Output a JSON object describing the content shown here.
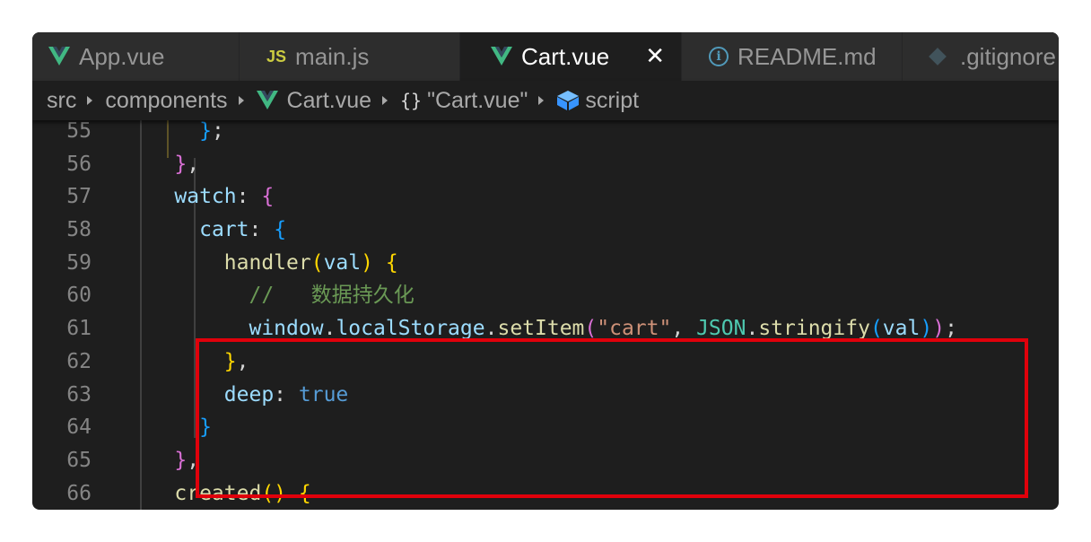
{
  "tabs": [
    {
      "label": "App.vue",
      "icon": "vue-icon",
      "active": false
    },
    {
      "label": "main.js",
      "icon": "js-icon",
      "icon_text": "JS",
      "active": false
    },
    {
      "label": "Cart.vue",
      "icon": "vue-icon",
      "active": true,
      "close": "✕"
    },
    {
      "label": "README.md",
      "icon": "info-icon",
      "icon_text": "i",
      "active": false
    },
    {
      "label": ".gitignore",
      "icon": "git-icon",
      "active": false
    }
  ],
  "breadcrumb": {
    "items": [
      "src",
      "components",
      "Cart.vue",
      "\"Cart.vue\"",
      "script"
    ],
    "braces": "{}"
  },
  "editor": {
    "line_numbers": [
      "55",
      "56",
      "57",
      "58",
      "59",
      "60",
      "61",
      "62",
      "63",
      "64",
      "65",
      "66"
    ],
    "lines": [
      [
        {
          "t": "      ",
          "c": "t-punct"
        },
        {
          "t": "}",
          "c": "t-b3"
        },
        {
          "t": ";",
          "c": "t-punct"
        }
      ],
      [
        {
          "t": "    ",
          "c": "t-punct"
        },
        {
          "t": "}",
          "c": "t-b2"
        },
        {
          "t": ",",
          "c": "t-punct"
        }
      ],
      [
        {
          "t": "    ",
          "c": "t-punct"
        },
        {
          "t": "watch",
          "c": "t-key"
        },
        {
          "t": ": ",
          "c": "t-punct"
        },
        {
          "t": "{",
          "c": "t-b2"
        }
      ],
      [
        {
          "t": "      ",
          "c": "t-punct"
        },
        {
          "t": "cart",
          "c": "t-key"
        },
        {
          "t": ": ",
          "c": "t-punct"
        },
        {
          "t": "{",
          "c": "t-b3"
        }
      ],
      [
        {
          "t": "        ",
          "c": "t-punct"
        },
        {
          "t": "handler",
          "c": "t-fn"
        },
        {
          "t": "(",
          "c": "t-b1"
        },
        {
          "t": "val",
          "c": "t-key"
        },
        {
          "t": ")",
          "c": "t-b1"
        },
        {
          "t": " ",
          "c": "t-punct"
        },
        {
          "t": "{",
          "c": "t-b1"
        }
      ],
      [
        {
          "t": "          ",
          "c": "t-punct"
        },
        {
          "t": "//   数据持久化",
          "c": "t-com"
        }
      ],
      [
        {
          "t": "          ",
          "c": "t-punct"
        },
        {
          "t": "window",
          "c": "t-key"
        },
        {
          "t": ".",
          "c": "t-punct"
        },
        {
          "t": "localStorage",
          "c": "t-key"
        },
        {
          "t": ".",
          "c": "t-punct"
        },
        {
          "t": "setItem",
          "c": "t-fn"
        },
        {
          "t": "(",
          "c": "t-b2"
        },
        {
          "t": "\"cart\"",
          "c": "t-str"
        },
        {
          "t": ", ",
          "c": "t-punct"
        },
        {
          "t": "JSON",
          "c": "t-cls"
        },
        {
          "t": ".",
          "c": "t-punct"
        },
        {
          "t": "stringify",
          "c": "t-fn"
        },
        {
          "t": "(",
          "c": "t-b3"
        },
        {
          "t": "val",
          "c": "t-key"
        },
        {
          "t": ")",
          "c": "t-b3"
        },
        {
          "t": ")",
          "c": "t-b2"
        },
        {
          "t": ";",
          "c": "t-punct"
        }
      ],
      [
        {
          "t": "        ",
          "c": "t-punct"
        },
        {
          "t": "}",
          "c": "t-b1"
        },
        {
          "t": ",",
          "c": "t-punct"
        }
      ],
      [
        {
          "t": "        ",
          "c": "t-punct"
        },
        {
          "t": "deep",
          "c": "t-key"
        },
        {
          "t": ": ",
          "c": "t-punct"
        },
        {
          "t": "true",
          "c": "t-kw"
        }
      ],
      [
        {
          "t": "      ",
          "c": "t-punct"
        },
        {
          "t": "}",
          "c": "t-b3"
        }
      ],
      [
        {
          "t": "    ",
          "c": "t-punct"
        },
        {
          "t": "}",
          "c": "t-b2"
        },
        {
          "t": ",",
          "c": "t-punct"
        }
      ],
      [
        {
          "t": "    ",
          "c": "t-punct"
        },
        {
          "t": "created",
          "c": "t-fn"
        },
        {
          "t": "()",
          "c": "t-b1"
        },
        {
          "t": " ",
          "c": "t-punct"
        },
        {
          "t": "{",
          "c": "t-b1"
        }
      ]
    ]
  },
  "colors": {
    "editor_bg": "#1e1e1e",
    "tabbar_bg": "#252526",
    "highlight_box": "#e0000b",
    "vue_green": "#41b883"
  }
}
